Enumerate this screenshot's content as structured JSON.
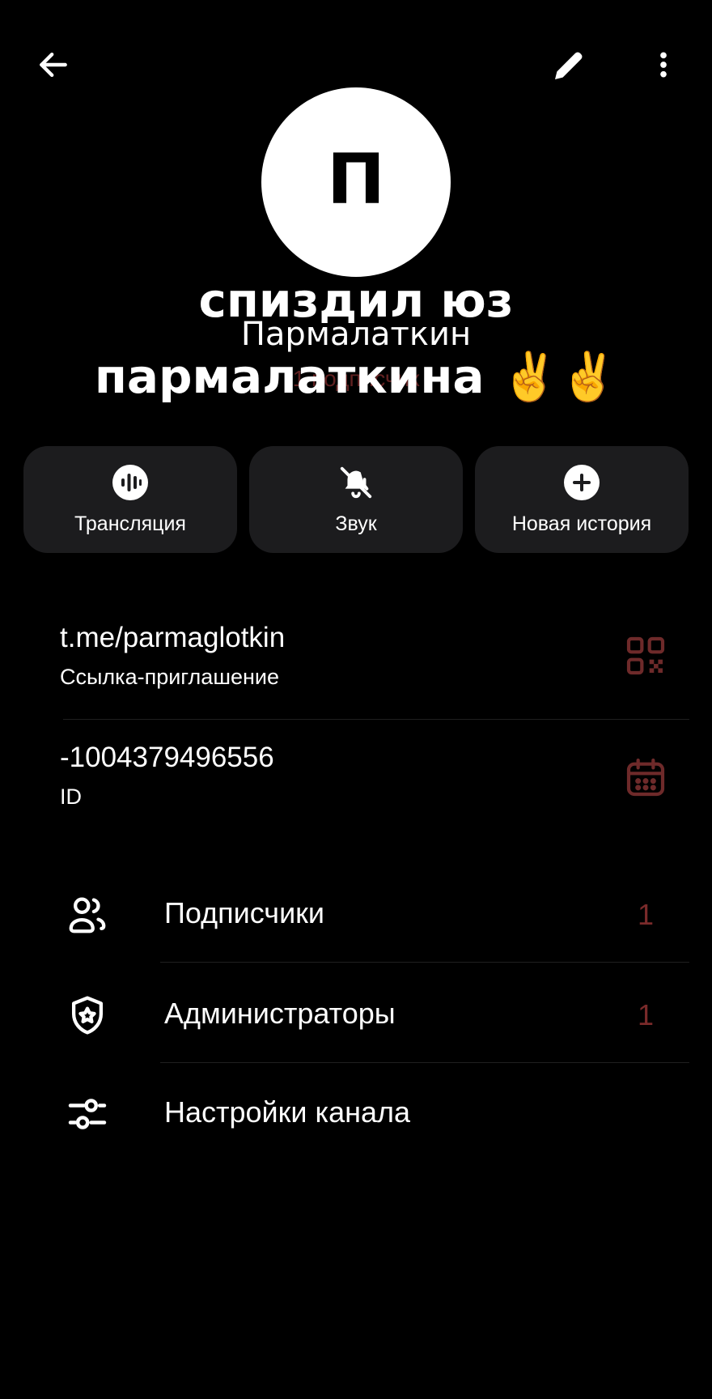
{
  "topbar": {
    "back_icon": "arrow-left-icon",
    "edit_icon": "pencil-icon",
    "more_icon": "more-vertical-icon"
  },
  "profile": {
    "avatar_letter": "П",
    "title_line1": "спиздил юз",
    "title_line2": "Пармалаткин",
    "title_line3": "пармалаткина ✌️✌️",
    "subtitle": "1 подписчик"
  },
  "actions": [
    {
      "label": "Трансляция",
      "icon": "broadcast-icon"
    },
    {
      "label": "Звук",
      "icon": "bell-off-icon"
    },
    {
      "label": "Новая история",
      "icon": "plus-circle-icon"
    }
  ],
  "info": {
    "link_value": "t.me/parmaglotkin",
    "link_caption": "Ссылка-приглашение",
    "link_icon": "qr-code-icon",
    "id_value": "-1004379496556",
    "id_caption": "ID",
    "id_icon": "calendar-icon"
  },
  "menu": [
    {
      "label": "Подписчики",
      "count": "1",
      "icon": "users-icon"
    },
    {
      "label": "Администраторы",
      "count": "1",
      "icon": "shield-star-icon"
    },
    {
      "label": "Настройки канала",
      "count": "",
      "icon": "sliders-icon"
    }
  ],
  "colors": {
    "background": "#000000",
    "card": "#1c1c1e",
    "accent_dim": "#7a2a2a",
    "text": "#ffffff"
  }
}
